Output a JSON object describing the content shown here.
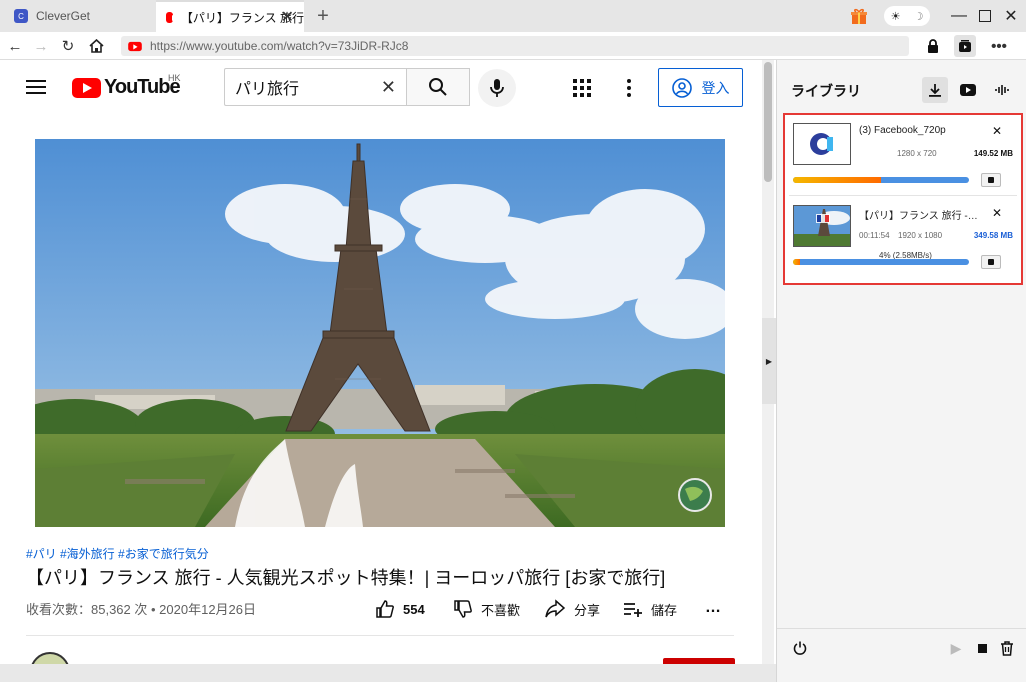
{
  "browser": {
    "tabs": [
      {
        "label": "CleverGet",
        "active": false
      },
      {
        "label": "【パリ】フランス 旅行",
        "active": true
      }
    ],
    "new_tab": "+",
    "url": "https://www.youtube.com/watch?v=73JiDR-RJc8"
  },
  "youtube": {
    "logo_text": "YouTube",
    "region": "HK",
    "search_query": "パリ旅行",
    "signin_label": "登入",
    "video": {
      "tags": "#パリ #海外旅行 #お家で旅行気分",
      "title": "【パリ】フランス 旅行 - 人気観光スポット特集！| ヨーロッパ旅行 [お家で旅行]",
      "views": "收看次數：85,362 次",
      "date": "2020年12月26日",
      "likes": "554",
      "dislike_label": "不喜歡",
      "share_label": "分享",
      "save_label": "儲存",
      "more": "…"
    }
  },
  "library": {
    "title": "ライブラリ",
    "items": [
      {
        "name": "(3) Facebook_720p",
        "resolution": "1280 x 720",
        "size": "149.52 MB",
        "progress": 0.5,
        "size_color": "#111111"
      },
      {
        "name": "【パリ】フランス 旅行 - 人気観光スポット特集",
        "duration": "00:11:54",
        "resolution": "1920 x 1080",
        "size": "349.58 MB",
        "progress_text": "4%  (2.58MB/s)",
        "progress": 0.04,
        "size_color": "#1a5fd6"
      }
    ]
  },
  "colors": {
    "youtube_red": "#ff0000",
    "link_blue": "#065fd4",
    "highlight_border": "#e53935"
  }
}
